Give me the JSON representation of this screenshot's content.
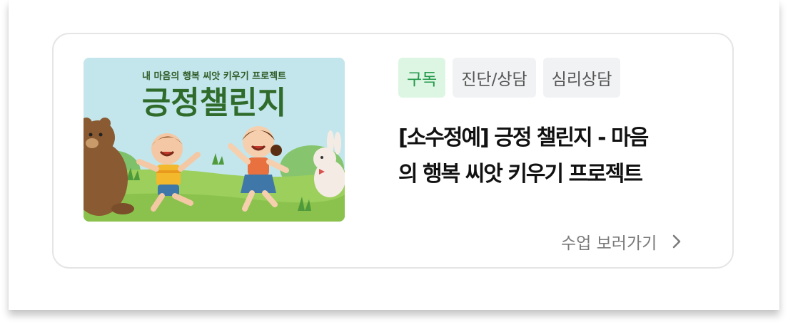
{
  "card": {
    "thumbnail": {
      "caption": "내 마음의 행복 씨앗 키우기 프로젝트",
      "title": "긍정챌린지"
    },
    "tags": [
      {
        "label": "구독"
      },
      {
        "label": "진단/상담"
      },
      {
        "label": "심리상담"
      }
    ],
    "title_line1": "[소수정예] 긍정 챌린지 - 마음",
    "title_line2": "의 행복 씨앗 키우기 프로젝트",
    "cta_label": "수업 보러가기",
    "cta_icon": "chevron-right-icon",
    "colors": {
      "subscribe_tag_bg": "#ddf6e3",
      "subscribe_tag_text": "#23984a",
      "thumb_title": "#2f6b2a"
    }
  }
}
